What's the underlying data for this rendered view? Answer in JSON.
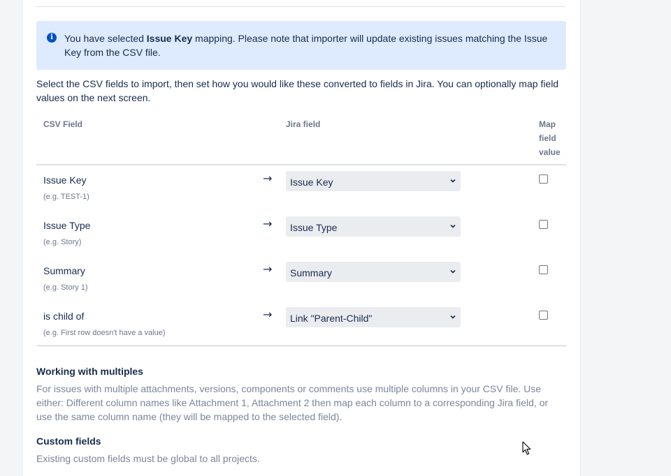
{
  "info": {
    "before": "You have selected ",
    "bold": "Issue Key",
    "after": " mapping. Please note that importer will update existing issues matching the Issue Key from the CSV file."
  },
  "intro": "Select the CSV fields to import, then set how you would like these converted to fields in Jira. You can optionally map field values on the next screen.",
  "table": {
    "headers": {
      "csv": "CSV Field",
      "jira": "Jira field",
      "map": "Map field value"
    },
    "rows": [
      {
        "csv": "Issue Key",
        "example": "(e.g. TEST-1)",
        "arrow": "→",
        "jira": "Issue Key",
        "map_checked": false
      },
      {
        "csv": "Issue Type",
        "example": "(e.g. Story)",
        "arrow": "→",
        "jira": "Issue Type",
        "map_checked": false
      },
      {
        "csv": "Summary",
        "example": "(e.g. Story 1)",
        "arrow": "→",
        "jira": "Summary",
        "map_checked": false
      },
      {
        "csv": "is child of",
        "example": "(e.g. First row doesn't have a value)",
        "arrow": "→",
        "jira": "Link \"Parent-Child\"",
        "map_checked": false
      }
    ]
  },
  "multiples": {
    "title": "Working with multiples",
    "text": "For issues with multiple attachments, versions, components or comments use multiple columns in your CSV file. Use either: Different column names like Attachment 1, Attachment 2 then map each column to a corresponding Jira field, or use the same column name (they will be mapped to the selected field)."
  },
  "custom": {
    "title": "Custom fields",
    "text": "Existing custom fields must be global to all projects."
  },
  "icons": {
    "info": "info-icon",
    "select": "chevron-down-icon",
    "cursor": "mouse-pointer-icon"
  },
  "colors": {
    "info_bg": "#deebff",
    "info_icon": "#0052cc",
    "select_bg": "#ebecf0"
  }
}
